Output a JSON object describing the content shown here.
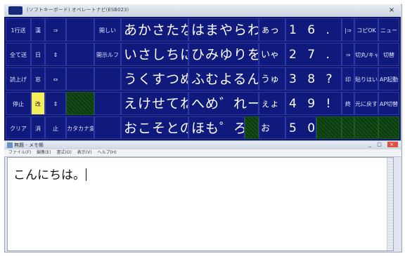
{
  "keyboard": {
    "title": "(ソフトキーボード) オペレートナビ(ESB023)",
    "close_label": "×",
    "rows": [
      [
        "1行送",
        "漢",
        "⇒",
        "",
        "開しい",
        "あかさたな",
        "はまやらわ",
        "ぁっ",
        "1 6 . (",
        "|⇒",
        "コピOK",
        "ニュー"
      ],
      [
        "全て送",
        "日",
        "⇕",
        "",
        "開示ルフ",
        "いさしちに",
        "ひみゆりを",
        "いゃ",
        "2 7 . )",
        "⇒",
        "切丸/キャン",
        "切替"
      ],
      [
        "読上げ",
        "窓",
        "⇔",
        "",
        "",
        "うくすつぬ",
        "ふむよるん",
        "うゅ",
        "3 8 ? 「",
        "印",
        "貼りはい",
        "AP起動"
      ],
      [
        "停止",
        "改",
        "⇕",
        "",
        "",
        "えけせてね",
        "へめ゛れー",
        "ぇょ",
        "4 9 ! 」",
        "終",
        "元に戻す",
        "AP切替"
      ],
      [
        "クリア",
        "消",
        "止",
        "カタカナ変",
        "",
        "おこそとの",
        "ほも゜ろ",
        "お",
        "5 0",
        "",
        "",
        ""
      ]
    ]
  },
  "notepad": {
    "title": "無題 - メモ帳",
    "window_buttons": "_ □",
    "close_label": "×",
    "menu": [
      "ファイル(F)",
      "編集(E)",
      "書式(O)",
      "表示(V)",
      "ヘルプ(H)"
    ],
    "text": "こんにちは。"
  }
}
